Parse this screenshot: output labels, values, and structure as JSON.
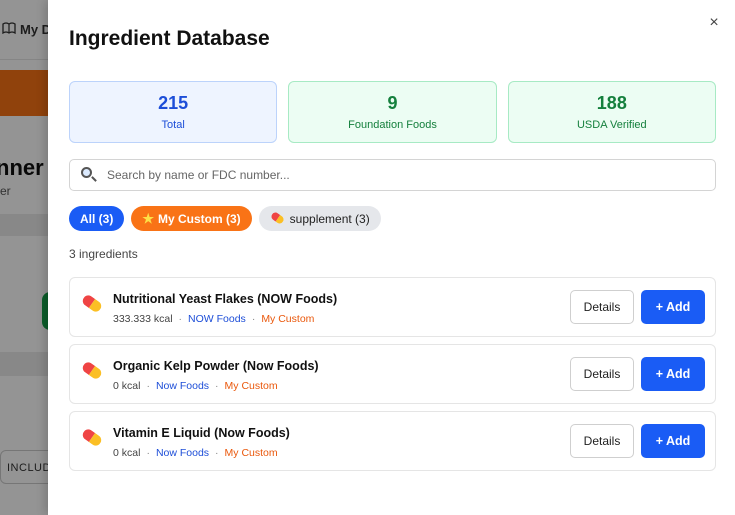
{
  "background": {
    "nav_label": "My D",
    "title_fragment": "nner",
    "subtitle_fragment": "er",
    "pill_label": "INCLUD"
  },
  "modal": {
    "title": "Ingredient Database",
    "close_symbol": "×",
    "stats": [
      {
        "value": "215",
        "label": "Total",
        "color": "#1d4ed8"
      },
      {
        "value": "9",
        "label": "Foundation Foods",
        "color": "#15803d"
      },
      {
        "value": "188",
        "label": "USDA Verified",
        "color": "#15803d"
      }
    ],
    "search": {
      "placeholder": "Search by name or FDC number...",
      "value": ""
    },
    "filters": [
      {
        "label": "All (3)",
        "active": true,
        "color": "#1a5cf5"
      },
      {
        "label": "My Custom (3)",
        "icon": "star-icon",
        "color": "#f97316"
      },
      {
        "label": "supplement (3)",
        "icon": "pill-icon"
      }
    ],
    "count_text": "3 ingredients",
    "items": [
      {
        "name": "Nutritional Yeast Flakes (NOW Foods)",
        "kcal": "333.333 kcal",
        "brand": "NOW Foods",
        "tag": "My Custom",
        "details_label": "Details",
        "add_label": "+ Add"
      },
      {
        "name": "Organic Kelp Powder (Now Foods)",
        "kcal": "0 kcal",
        "brand": "Now Foods",
        "tag": "My Custom",
        "details_label": "Details",
        "add_label": "+ Add"
      },
      {
        "name": "Vitamin E Liquid (Now Foods)",
        "kcal": "0 kcal",
        "brand": "Now Foods",
        "tag": "My Custom",
        "details_label": "Details",
        "add_label": "+ Add"
      }
    ],
    "separator": "·"
  }
}
